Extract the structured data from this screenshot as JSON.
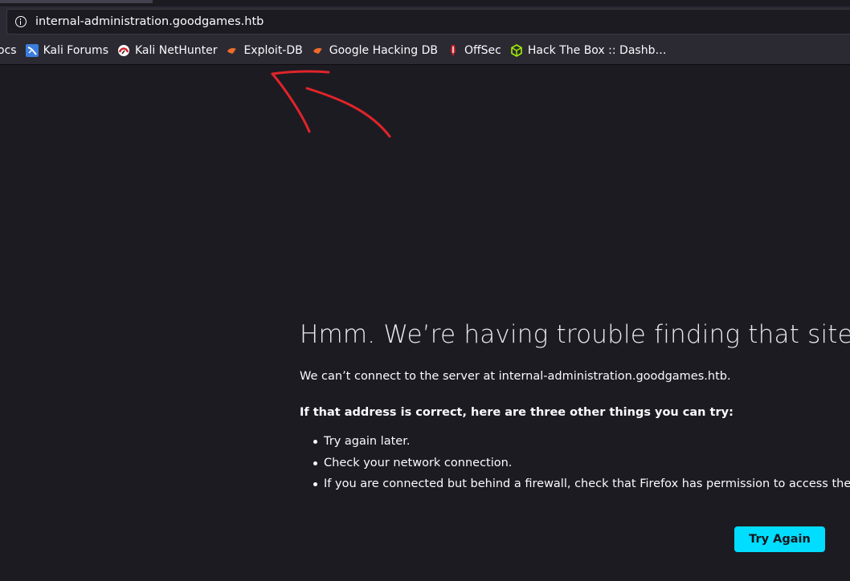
{
  "urlbar": {
    "url": "internal-administration.goodgames.htb"
  },
  "bookmarks": [
    {
      "label": "ocs",
      "icon": "none"
    },
    {
      "label": "Kali Forums",
      "icon": "kali-forums-icon"
    },
    {
      "label": "Kali NetHunter",
      "icon": "kali-nethunter-icon"
    },
    {
      "label": "Exploit-DB",
      "icon": "exploit-db-icon"
    },
    {
      "label": "Google Hacking DB",
      "icon": "google-hacking-db-icon"
    },
    {
      "label": "OffSec",
      "icon": "offsec-icon"
    },
    {
      "label": "Hack The Box :: Dashb…",
      "icon": "hack-the-box-icon"
    }
  ],
  "error": {
    "title": "Hmm. We’re having trouble finding that site.",
    "description": "We can’t connect to the server at internal-administration.goodgames.htb.",
    "suggestions_heading": "If that address is correct, here are three other things you can try:",
    "suggestions": [
      "Try again later.",
      "Check your network connection.",
      "If you are connected but behind a firewall, check that Firefox has permission to access the Web."
    ],
    "button_label": "Try Again"
  },
  "colors": {
    "page_bg": "#1c1b22",
    "toolbar_bg": "#2b2a33",
    "text": "#fbfbfe",
    "button_bg": "#00ddff",
    "annotation": "#e0242a"
  }
}
